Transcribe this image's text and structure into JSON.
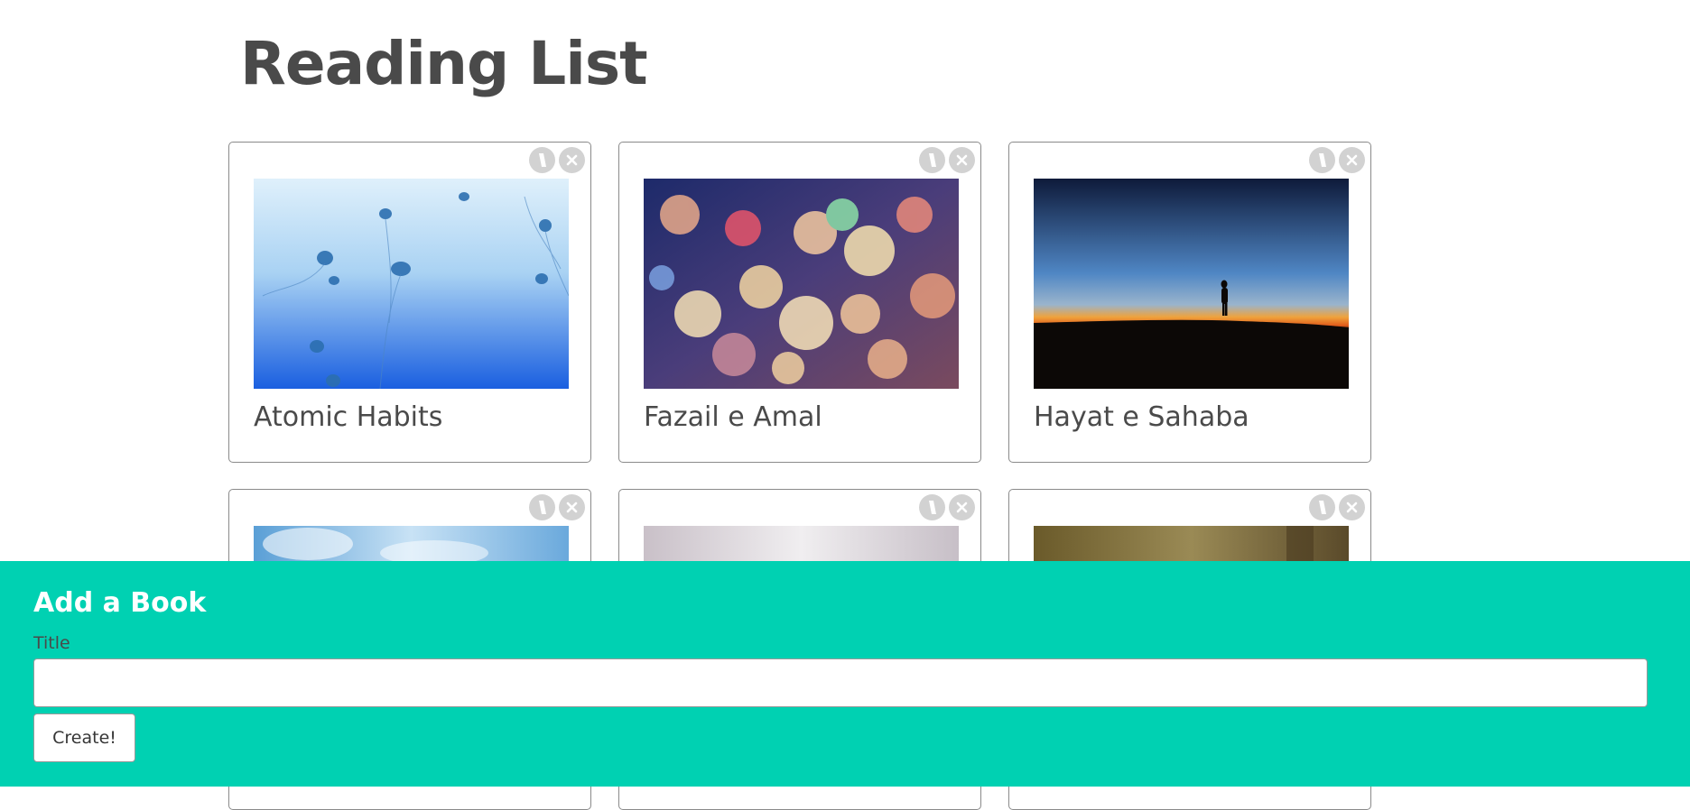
{
  "page": {
    "title": "Reading List"
  },
  "books": [
    {
      "title": "Atomic Habits",
      "image": "jellyfish-photo"
    },
    {
      "title": "Fazail e Amal",
      "image": "bokeh-lights-photo"
    },
    {
      "title": "Hayat e Sahaba",
      "image": "sunset-silhouette-photo"
    },
    {
      "title": "",
      "image": "sky-clouds-photo"
    },
    {
      "title": "",
      "image": "misty-sky-photo"
    },
    {
      "title": "",
      "image": "forest-photo"
    }
  ],
  "card_icons": {
    "edit": "edit-icon",
    "delete": "close-icon"
  },
  "form": {
    "heading": "Add a Book",
    "title_label": "Title",
    "title_value": "",
    "create_label": "Create!"
  },
  "colors": {
    "panel": "#00d1b2",
    "title": "#4a4a4a",
    "icon_bg": "#d2d2d2"
  }
}
